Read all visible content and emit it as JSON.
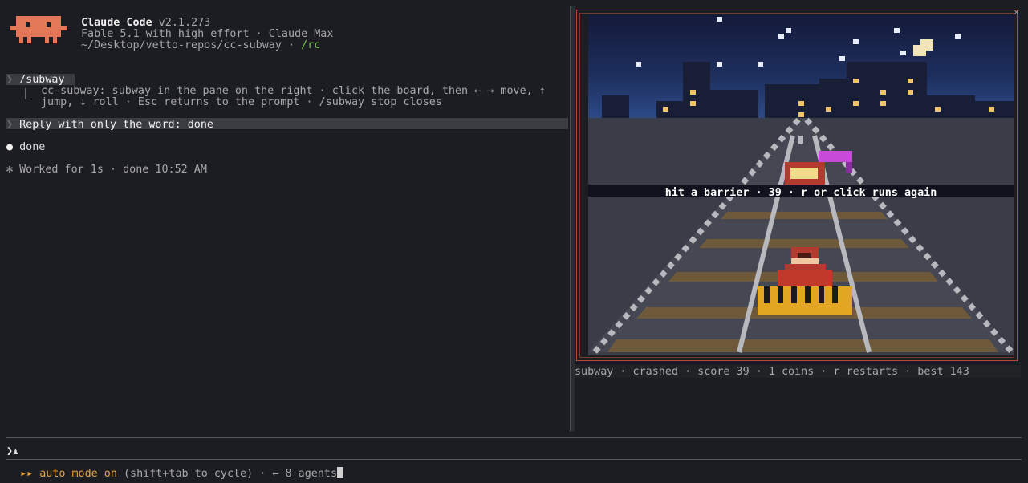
{
  "colors": {
    "accent": "#e8795a",
    "amber": "#e8a33b",
    "green": "#7ac24a"
  },
  "header": {
    "app_name": "Claude Code",
    "version": "v2.1.273",
    "model_line": "Fable 5.1 with high effort · Claude Max",
    "path": "~/Desktop/vetto-repos/cc-subway",
    "path_sep": " · ",
    "rc": "/rc"
  },
  "transcript": {
    "command": "/subway",
    "command_output_line1": "cc-subway: subway in the pane on the right · click the board, then ← → move, ↑",
    "command_output_line2": "jump, ↓ roll · Esc returns to the prompt · /subway stop closes",
    "user_message": "Reply with only the word: done",
    "assistant_reply": "done",
    "worked_status": "Worked for 1s · done 10:52 AM"
  },
  "game": {
    "overlay_message": "hit a barrier · 39 · r or click runs again",
    "status_line": "subway · crashed · score 39 · 1 coins · r restarts · best 143",
    "close_glyph": "×"
  },
  "prompt": {
    "chevron": "❯",
    "value": ""
  },
  "footer": {
    "mode_arrows": "▸▸",
    "mode_label": "auto mode on",
    "hint": " (shift+tab to cycle) · ← 8 agents"
  }
}
